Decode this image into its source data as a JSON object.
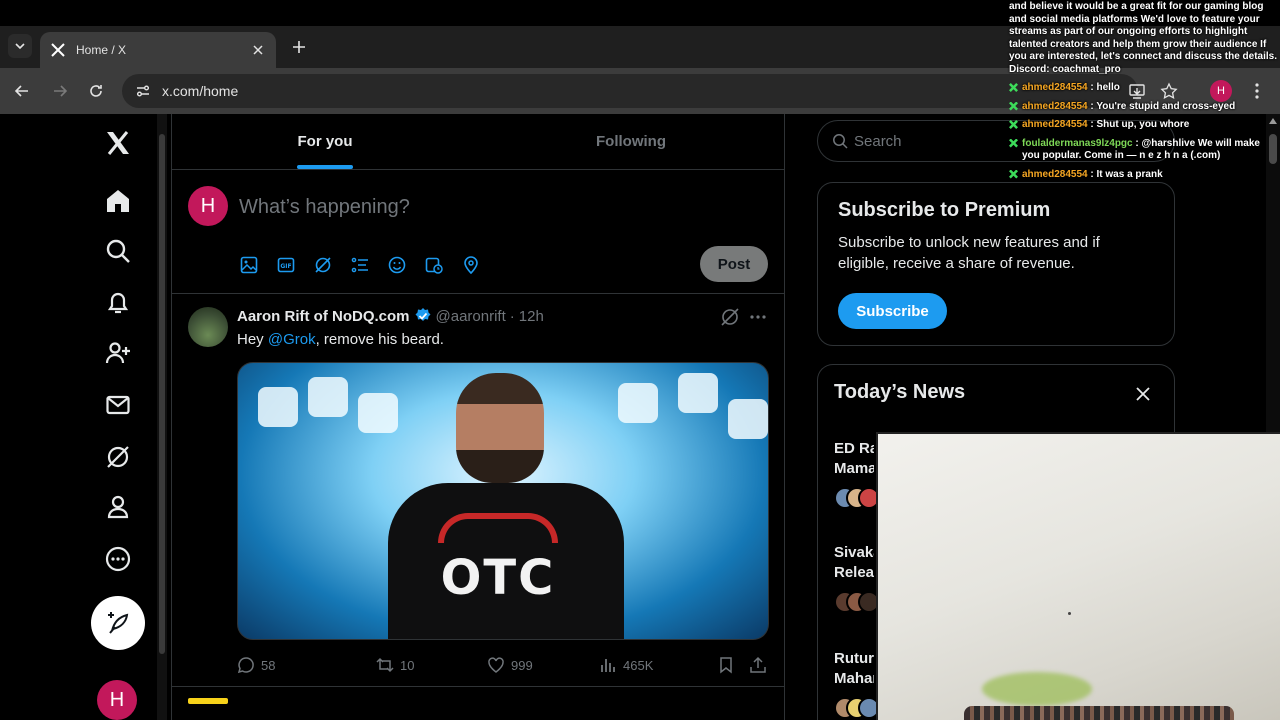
{
  "browser": {
    "tab_title": "Home / X",
    "url": "x.com/home",
    "profile_initial": "H"
  },
  "nav": {
    "avatar_initial": "H",
    "items": [
      "x-logo",
      "home-icon",
      "explore-icon",
      "notifications-icon",
      "communities-icon",
      "messages-icon",
      "grok-icon",
      "profile-icon",
      "more-icon"
    ]
  },
  "timeline": {
    "tabs": [
      {
        "label": "For you",
        "active": true
      },
      {
        "label": "Following",
        "active": false
      }
    ]
  },
  "composer": {
    "avatar_initial": "H",
    "placeholder": "What’s happening?",
    "post_label": "Post"
  },
  "tweet": {
    "display_name": "Aaron Rift of NoDQ.com",
    "handle": "@aaronrift",
    "separator": "·",
    "time": "12h",
    "text_prefix": "Hey ",
    "mention": "@Grok",
    "text_suffix": ", remove his beard.",
    "shirt_text": "OTC",
    "replies": "58",
    "reposts": "10",
    "likes": "999",
    "views": "465K"
  },
  "right": {
    "search_placeholder": "Search",
    "premium": {
      "title": "Subscribe to Premium",
      "body": "Subscribe to unlock new features and if eligible, receive a share of revenue.",
      "button": "Subscribe"
    },
    "news": {
      "title": "Today’s News",
      "items": [
        {
          "line1": "ED Ra",
          "line2": "Mama"
        },
        {
          "line1": "Sivaka",
          "line2": "Releas"
        },
        {
          "line1": "Rutura",
          "line2": "Mahar"
        }
      ]
    }
  },
  "chat": {
    "intro": "and believe it would be a great fit for our gaming blog and social media platforms We'd love to feature your streams as part of our ongoing efforts to highlight talented creators and help them grow their audience If you are interested, let's connect and discuss the details. Discord: coachmat_pro",
    "messages": [
      {
        "user": "ahmed284554",
        "text": " : hello"
      },
      {
        "user": "ahmed284554",
        "text": " : You're stupid and cross-eyed"
      },
      {
        "user": "ahmed284554",
        "text": " : Shut up, you whore"
      },
      {
        "user": "foulaldermanas9lz4pgc",
        "text": " : @harshlive We will make you popular. Come in — n e z h n a (.com)"
      },
      {
        "user": "ahmed284554",
        "text": " : It was a prank"
      }
    ]
  },
  "colors": {
    "accent": "#1d9bf0",
    "avatar": "#c2185b",
    "background": "#000000",
    "border": "#2f3336",
    "muted_text": "#71767b",
    "chat_user": "#f5a623",
    "chat_user_alt": "#7ed957"
  }
}
